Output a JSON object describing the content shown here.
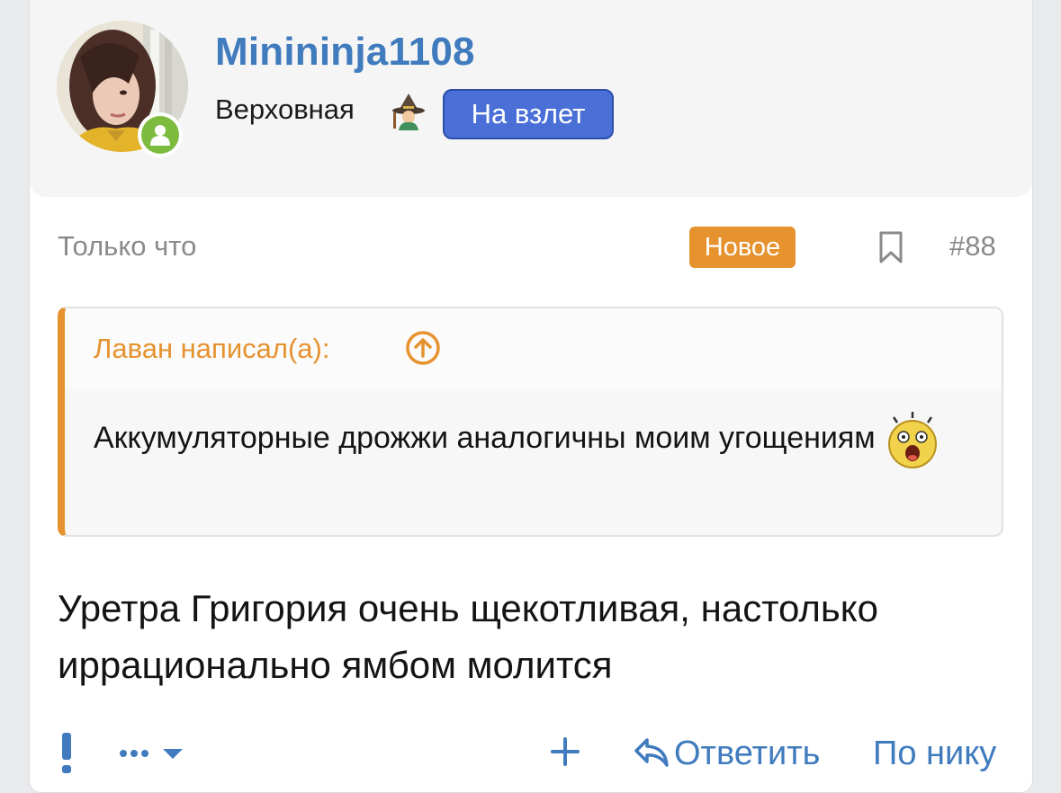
{
  "user": {
    "username": "Minininja1108",
    "title": "Верховная",
    "title_emoji": "witch-emoji",
    "banner": "На взлет",
    "online": true
  },
  "post": {
    "date": "Только что",
    "new_badge": "Новое",
    "number": "#88"
  },
  "quote": {
    "author": "Лаван написал(а):",
    "text": "Аккумуляторные дрожжи аналогичны моим угощениям",
    "smiley": "shocked-face"
  },
  "message": {
    "text": "Уретра Григория очень щекотливая, настолько иррационально ямбом молится"
  },
  "actions": {
    "reply": "Ответить",
    "by_nick": "По нику"
  },
  "colors": {
    "accent": "#3f7bbd",
    "banner": "#4a6fd6",
    "new": "#e6922f",
    "online": "#7dbb3f"
  }
}
